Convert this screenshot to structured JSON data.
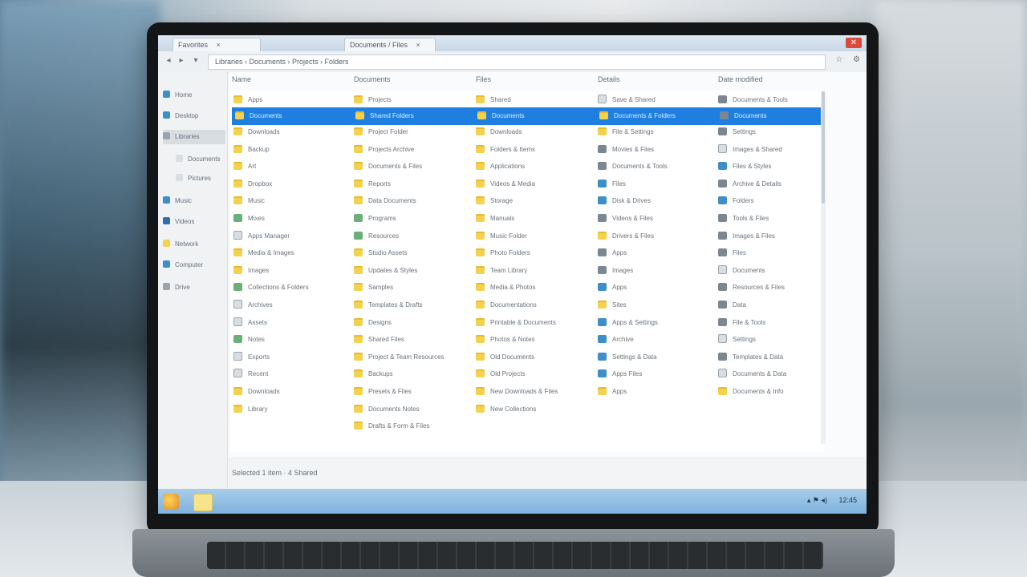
{
  "window": {
    "tabs": [
      "Favorites",
      "Documents / Files"
    ],
    "close_glyph": "✕",
    "tab_close_glyph": "×"
  },
  "addressbar": {
    "back_glyph": "◂",
    "forward_glyph": "▸",
    "path": "Libraries › Documents › Projects › Folders",
    "tools": [
      "☆",
      "⚙"
    ]
  },
  "sidebar": {
    "items": [
      {
        "label": "Home",
        "icon": "home-icon",
        "color": "#3d8fc9"
      },
      {
        "label": "Desktop",
        "icon": "desktop-icon",
        "color": "#3d8fc9"
      },
      {
        "label": "Libraries",
        "icon": "library-icon",
        "color": "#9aa4ad"
      },
      {
        "label": "Documents",
        "icon": "documents-icon",
        "color": "#d9dee3"
      },
      {
        "label": "Pictures",
        "icon": "pictures-icon",
        "color": "#d9dee3"
      },
      {
        "label": "Music",
        "icon": "music-icon",
        "color": "#3d8fc9"
      },
      {
        "label": "Videos",
        "icon": "videos-icon",
        "color": "#2f6fae"
      },
      {
        "label": "Network",
        "icon": "network-icon",
        "color": "#f3d24e"
      },
      {
        "label": "Computer",
        "icon": "computer-icon",
        "color": "#3d8fc9"
      },
      {
        "label": "Drive",
        "icon": "drive-icon",
        "color": "#9aa4ad"
      }
    ]
  },
  "columns": [
    "Name",
    "Documents",
    "Files",
    "Details",
    "Date modified"
  ],
  "files": {
    "col1": [
      "Apps",
      "Downloads",
      "Backup",
      "Art",
      "Dropbox",
      "Music",
      "Mixes",
      "Apps Manager",
      "Media & Images",
      "Images",
      "Collections & Folders",
      "Archives",
      "Assets",
      "Notes",
      "Exports",
      "Recent",
      "Downloads",
      "Library"
    ],
    "col2": [
      "Projects",
      "Project Folder",
      "Projects Archive",
      "Documents & Files",
      "Reports",
      "Data Documents",
      "Programs",
      "Resources",
      "Studio Assets",
      "Updates & Styles",
      "Samples",
      "Templates & Drafts",
      "Designs",
      "Shared Files",
      "Project & Team Resources",
      "Backups",
      "Presets & Files",
      "Documents Notes",
      "Drafts & Form & Files"
    ],
    "col3": [
      "Shared",
      "Downloads",
      "Folders & Items",
      "Applications",
      "Videos & Media",
      "Storage",
      "Manuals",
      "Music Folder",
      "Photo Folders",
      "Team Library",
      "Media & Photos",
      "Documentations",
      "Printable & Documents",
      "Photos & Notes",
      "Old Documents",
      "Old Projects",
      "New Downloads & Files",
      "New Collections"
    ],
    "col4": [
      "Save & Shared",
      "File & Settings",
      "Movies & Files",
      "Documents & Tools",
      "Files",
      "Disk & Drives",
      "Videos & Files",
      "Drivers & Files",
      "Apps",
      "Images",
      "Apps",
      "Sites",
      "Apps & Settings",
      "Archive",
      "Settings & Data",
      "Apps Files",
      "Apps"
    ],
    "col5": [
      "Documents & Tools",
      "Settings",
      "Images & Shared",
      "Files & Styles",
      "Archive & Details",
      "Folders",
      "Tools & Files",
      "Images & Files",
      "Files",
      "Documents",
      "Resources & Files",
      "Data",
      "File & Tools",
      "Settings",
      "Templates & Data",
      "Documents & Data",
      "Documents & Info"
    ],
    "icons1": [
      "folder",
      "folder",
      "folder",
      "folder",
      "folder",
      "folder",
      "green",
      "doc",
      "folder",
      "folder",
      "green",
      "doc",
      "doc",
      "green",
      "doc",
      "doc",
      "folder"
    ],
    "icons2": [
      "folder",
      "folder",
      "folder",
      "folder",
      "folder",
      "folder",
      "green",
      "green",
      "folder",
      "folder",
      "folder",
      "folder",
      "folder",
      "folder",
      "folder",
      "folder",
      "folder",
      "folder"
    ],
    "icons3": [
      "folder",
      "folder",
      "folder",
      "folder",
      "folder",
      "folder",
      "folder",
      "folder",
      "folder",
      "folder",
      "folder",
      "folder",
      "folder",
      "folder",
      "folder",
      "folder",
      "folder"
    ],
    "icons4": [
      "doc",
      "folder",
      "img",
      "img",
      "app",
      "app",
      "img",
      "folder",
      "img",
      "img",
      "app",
      "folder",
      "app",
      "app",
      "app",
      "app"
    ],
    "icons5": [
      "img",
      "img",
      "doc",
      "app",
      "img",
      "app",
      "img",
      "img",
      "img",
      "doc",
      "img",
      "img",
      "img",
      "doc",
      "img",
      "doc"
    ]
  },
  "selected": {
    "items": [
      "Documents",
      "Shared Folders",
      "Documents",
      "Documents & Folders",
      "Documents"
    ]
  },
  "status": {
    "text": "Selected 1 item · 4 Shared"
  },
  "taskbar": {
    "tray": [
      "▴ ⚑ ◂)",
      "12:45"
    ]
  }
}
